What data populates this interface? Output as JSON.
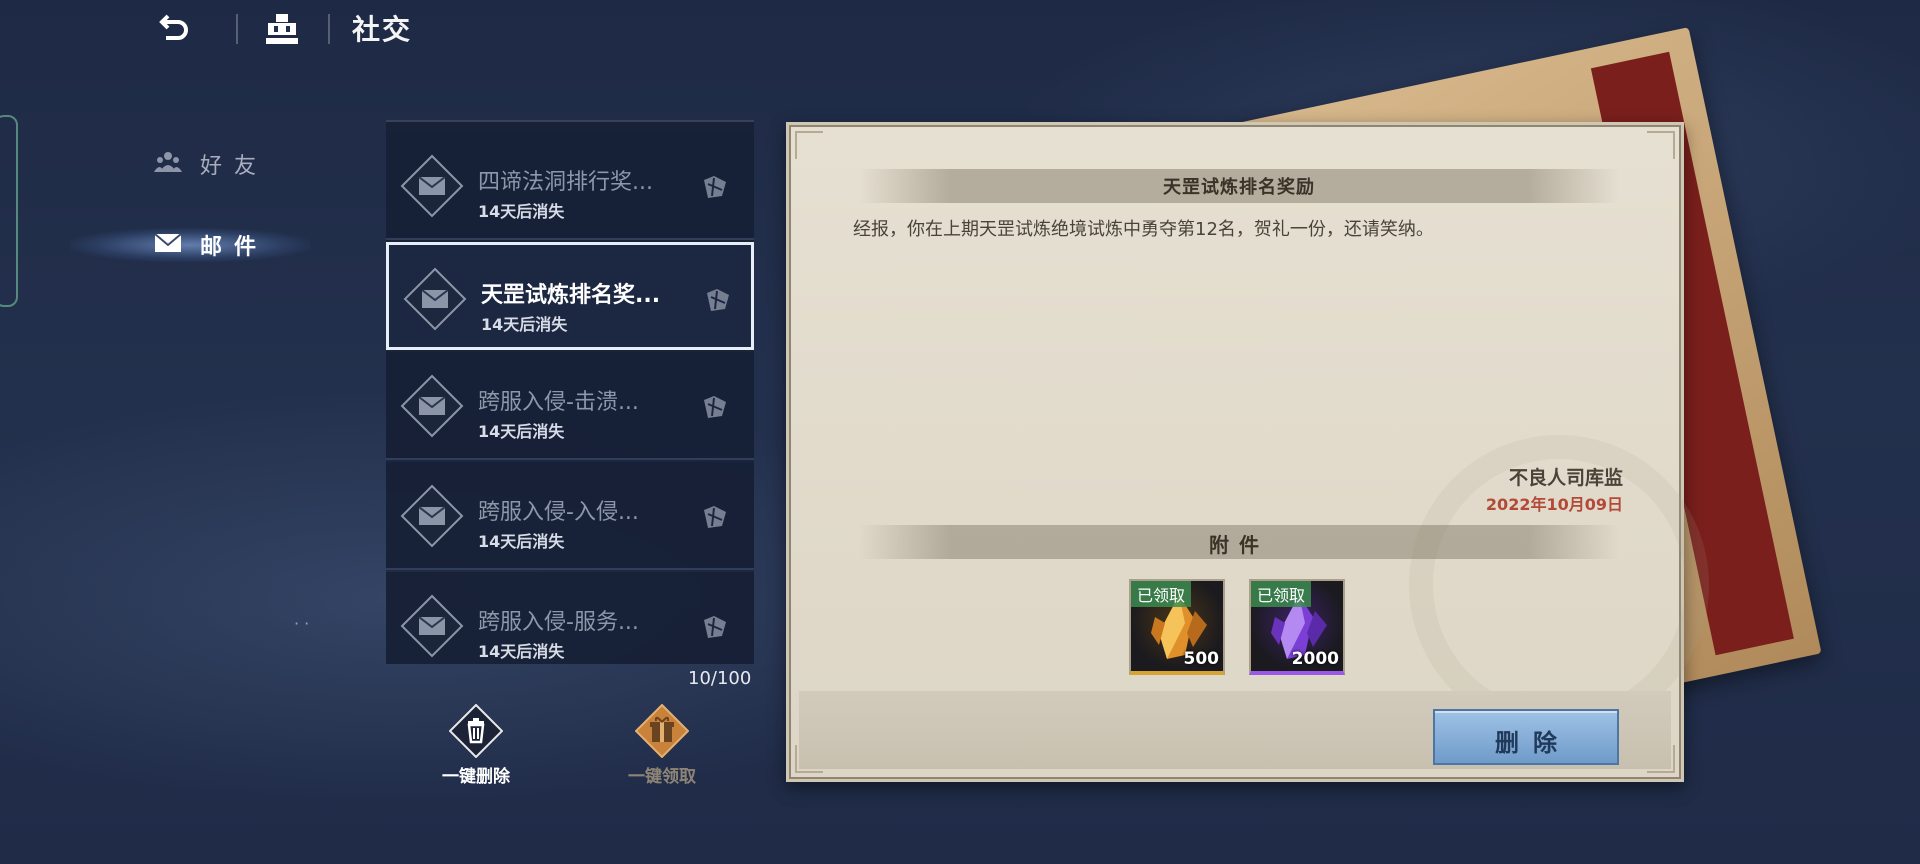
{
  "header": {
    "title": "社交"
  },
  "sidebar": {
    "items": [
      {
        "label": "好友",
        "icon": "friends-icon",
        "active": false
      },
      {
        "label": "邮件",
        "icon": "envelope-icon",
        "active": true
      }
    ]
  },
  "mail_list": {
    "items": [
      {
        "title": "四谛法洞排行奖...",
        "expires": "14天后消失",
        "selected": false
      },
      {
        "title": "天罡试炼排名奖...",
        "expires": "14天后消失",
        "selected": true
      },
      {
        "title": "跨服入侵-击溃...",
        "expires": "14天后消失",
        "selected": false
      },
      {
        "title": "跨服入侵-入侵...",
        "expires": "14天后消失",
        "selected": false
      },
      {
        "title": "跨服入侵-服务...",
        "expires": "14天后消失",
        "selected": false
      }
    ],
    "count": "10/100"
  },
  "actions": {
    "delete_all": "一键删除",
    "claim_all": "一键领取"
  },
  "mail_detail": {
    "title": "天罡试炼排名奖励",
    "body": "经报，你在上期天罡试炼绝境试炼中勇夺第12名，贺礼一份，还请笑纳。",
    "sender": "不良人司库监",
    "date": "2022年10月09日",
    "attachments_header": "附件",
    "attachments": [
      {
        "status": "已领取",
        "quantity": "500",
        "rarity_color": "#d7a433",
        "icon": "gold-crystal-icon"
      },
      {
        "status": "已领取",
        "quantity": "2000",
        "rarity_color": "#9b58e8",
        "icon": "purple-crystal-icon"
      }
    ],
    "delete_label": "删除"
  },
  "colors": {
    "background": "#23304d",
    "panel": "#e2dccd",
    "date": "#b34a38",
    "delete_button": "#7fa8d4"
  }
}
